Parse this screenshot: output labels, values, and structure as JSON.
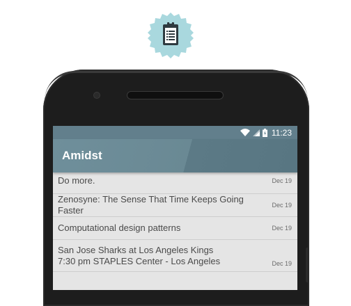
{
  "badge": {
    "icon": "clipboard-icon",
    "color": "#a9d8de"
  },
  "statusbar": {
    "time": "11:23",
    "icons": [
      "wifi-icon",
      "signal-icon",
      "battery-icon"
    ]
  },
  "app": {
    "title": "Amidst",
    "accent": "#627f8c"
  },
  "items": [
    {
      "title": "Do more.",
      "date": "Dec 19"
    },
    {
      "title": "Zenosyne: The Sense That Time Keeps Going Faster",
      "date": "Dec 19"
    },
    {
      "title": "Computational design patterns",
      "date": "Dec 19"
    },
    {
      "title_line1": "San Jose Sharks at Los Angeles Kings",
      "title_line2": "7:30 pm STAPLES Center - Los Angeles",
      "date": "Dec 19"
    }
  ]
}
